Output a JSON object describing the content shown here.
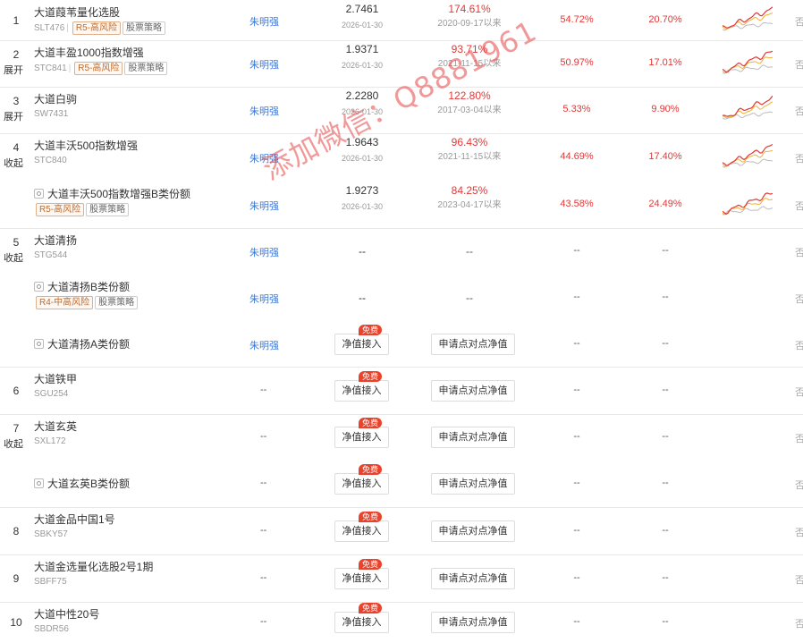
{
  "colors": {
    "red": "#e23838",
    "manager_blue": "#3d7ad8",
    "badge": "#e8432c"
  },
  "watermark": "添加微信：Q8881961",
  "rows": [
    {
      "idx": "1",
      "expand": "",
      "name": "大道葭苇量化选股",
      "code": "SLT476",
      "risk": "R5-高风险",
      "strategy": "股票策略",
      "manager": "朱明强",
      "nav": "2.7461",
      "nav_date": "2026-01-30",
      "since": "174.61%",
      "since_date": "2020-09-17以来",
      "r1": "54.72%",
      "r2": "20.70%",
      "spark": "spark-chart-icon",
      "edge": "否",
      "type": "main"
    },
    {
      "idx": "2",
      "expand": "展开",
      "name": "大道丰盈1000指数增强",
      "code": "STC841",
      "risk": "R5-高风险",
      "strategy": "股票策略",
      "manager": "朱明强",
      "nav": "1.9371",
      "nav_date": "2026-01-30",
      "since": "93.71%",
      "since_date": "2021-11-15以来",
      "r1": "50.97%",
      "r2": "17.01%",
      "spark": "spark-chart-icon",
      "edge": "否",
      "type": "main"
    },
    {
      "idx": "3",
      "expand": "展开",
      "name": "大道白驹",
      "code": "SW7431",
      "risk": "",
      "strategy": "",
      "manager": "朱明强",
      "nav": "2.2280",
      "nav_date": "2026-01-30",
      "since": "122.80%",
      "since_date": "2017-03-04以来",
      "r1": "5.33%",
      "r2": "9.90%",
      "spark": "spark-chart-icon",
      "edge": "否",
      "type": "main"
    },
    {
      "idx": "4",
      "expand": "收起",
      "name": "大道丰沃500指数增强",
      "code": "STC840",
      "risk": "",
      "strategy": "",
      "manager": "朱明强",
      "nav": "1.9643",
      "nav_date": "2026-01-30",
      "since": "96.43%",
      "since_date": "2021-11-15以来",
      "r1": "44.69%",
      "r2": "17.40%",
      "spark": "spark-chart-icon",
      "edge": "否",
      "type": "main"
    },
    {
      "idx": "",
      "expand": "",
      "name": "大道丰沃500指数增强B类份额",
      "code": "",
      "risk": "R5-高风险",
      "strategy": "股票策略",
      "manager": "朱明强",
      "nav": "1.9273",
      "nav_date": "2026-01-30",
      "since": "84.25%",
      "since_date": "2023-04-17以来",
      "r1": "43.58%",
      "r2": "24.49%",
      "spark": "spark-chart-icon",
      "edge": "否",
      "type": "sub"
    },
    {
      "idx": "5",
      "expand": "收起",
      "name": "大道清扬",
      "code": "STG544",
      "risk": "",
      "strategy": "",
      "manager": "朱明强",
      "nav": "--",
      "nav_date": "",
      "since": "--",
      "since_date": "",
      "r1": "--",
      "r2": "--",
      "spark": "",
      "edge": "否",
      "type": "main"
    },
    {
      "idx": "",
      "expand": "",
      "name": "大道清扬B类份额",
      "code": "",
      "risk": "R4-中高风险",
      "strategy": "股票策略",
      "manager": "朱明强",
      "nav": "--",
      "nav_date": "",
      "since": "--",
      "since_date": "",
      "r1": "--",
      "r2": "--",
      "spark": "",
      "edge": "否",
      "type": "sub"
    },
    {
      "idx": "",
      "expand": "",
      "name": "大道清扬A类份额",
      "code": "",
      "risk": "",
      "strategy": "",
      "manager": "朱明强",
      "nav_btn": "净值接入",
      "badge": "免费",
      "compare_btn": "申请点对点净值",
      "r1": "--",
      "r2": "--",
      "edge": "否",
      "type": "sub-btn"
    },
    {
      "idx": "6",
      "expand": "",
      "name": "大道铁甲",
      "code": "SGU254",
      "risk": "",
      "strategy": "",
      "manager": "--",
      "nav_btn": "净值接入",
      "badge": "免费",
      "compare_btn": "申请点对点净值",
      "r1": "--",
      "r2": "--",
      "edge": "否",
      "type": "main-btn"
    },
    {
      "idx": "7",
      "expand": "收起",
      "name": "大道玄英",
      "code": "SXL172",
      "risk": "",
      "strategy": "",
      "manager": "--",
      "nav_btn": "净值接入",
      "badge": "免费",
      "compare_btn": "申请点对点净值",
      "r1": "--",
      "r2": "--",
      "edge": "否",
      "type": "main-btn"
    },
    {
      "idx": "",
      "expand": "",
      "name": "大道玄英B类份额",
      "code": "",
      "risk": "",
      "strategy": "",
      "manager": "--",
      "nav_btn": "净值接入",
      "badge": "免费",
      "compare_btn": "申请点对点净值",
      "r1": "--",
      "r2": "--",
      "edge": "否",
      "type": "sub-btn"
    },
    {
      "idx": "8",
      "expand": "",
      "name": "大道金品中国1号",
      "code": "SBKY57",
      "risk": "",
      "strategy": "",
      "manager": "--",
      "nav_btn": "净值接入",
      "badge": "免费",
      "compare_btn": "申请点对点净值",
      "r1": "--",
      "r2": "--",
      "edge": "否",
      "type": "main-btn"
    },
    {
      "idx": "9",
      "expand": "",
      "name": "大道金选量化选股2号1期",
      "code": "SBFF75",
      "risk": "",
      "strategy": "",
      "manager": "--",
      "nav_btn": "净值接入",
      "badge": "免费",
      "compare_btn": "申请点对点净值",
      "r1": "--",
      "r2": "--",
      "edge": "否",
      "type": "main-btn"
    },
    {
      "idx": "10",
      "expand": "",
      "name": "大道中性20号",
      "code": "SBDR56",
      "risk": "",
      "strategy": "",
      "manager": "--",
      "nav_btn": "净值接入",
      "badge": "免费",
      "compare_btn": "申请点对点净值",
      "r1": "--",
      "r2": "--",
      "edge": "否",
      "type": "main-btn"
    }
  ]
}
